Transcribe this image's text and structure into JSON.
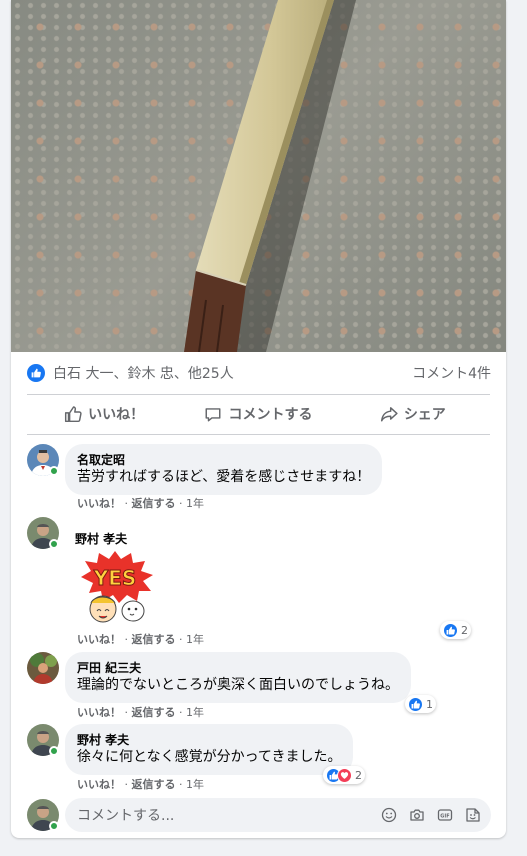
{
  "post": {
    "reactions": {
      "names": "白石 大一、鈴木 忠、他25人",
      "comments_count": "コメント4件"
    },
    "actions": {
      "like": "いいね！",
      "comment": "コメントする",
      "share": "シェア"
    }
  },
  "comments": [
    {
      "author": "名取定昭",
      "text": "苦労すればするほど、愛着を感じさせますね！",
      "like": "いいね！",
      "reply": "返信する",
      "time": "1年"
    },
    {
      "author": "野村 孝夫",
      "sticker": "YES",
      "like": "いいね！",
      "reply": "返信する",
      "time": "1年",
      "reaction_count": "2"
    },
    {
      "author": "戸田 紀三夫",
      "text": "理論的でないところが奥深く面白いのでしょうね。",
      "like": "いいね！",
      "reply": "返信する",
      "time": "1年",
      "reaction_count": "1"
    },
    {
      "author": "野村 孝夫",
      "text": "徐々に何となく感覚が分かってきました。",
      "like": "いいね！",
      "reply": "返信する",
      "time": "1年",
      "reaction_count": "2"
    }
  ],
  "composer": {
    "placeholder": "コメントする..."
  },
  "colors": {
    "like_blue": "#1877f2",
    "love_red": "#f33e58",
    "online_green": "#31a24c",
    "text_secondary": "#65676b"
  },
  "icons": [
    "like-icon",
    "comment-icon",
    "share-icon",
    "emoji-icon",
    "camera-icon",
    "gif-icon",
    "sticker-icon"
  ]
}
